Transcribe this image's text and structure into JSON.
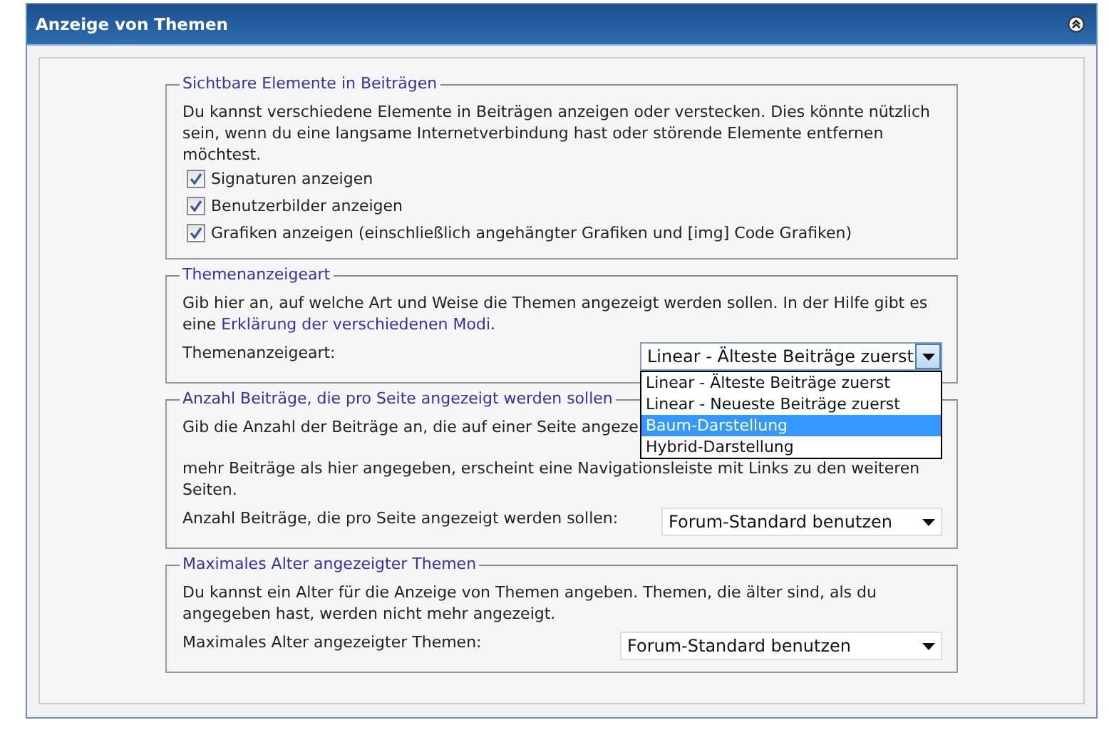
{
  "window": {
    "title": "Anzeige von Themen"
  },
  "sections": [
    {
      "legend": "Sichtbare Elemente in Beiträgen",
      "description": [
        "Du kannst verschiedene Elemente in Beiträgen anzeigen oder verstecken. Dies könnte nützlich sein, wenn du eine langsame Internetverbindung hast oder störende Elemente entfernen möchtest."
      ],
      "checkboxes": [
        {
          "label": "Signaturen anzeigen",
          "checked": true
        },
        {
          "label": "Benutzerbilder anzeigen",
          "checked": true
        },
        {
          "label": "Grafiken anzeigen (einschließlich angehängter Grafiken und [img] Code Grafiken)",
          "checked": true
        }
      ]
    },
    {
      "legend": "Themenanzeigeart",
      "description": [
        {
          "before": "Gib hier an, auf welche Art und Weise die Themen angezeigt werden sollen. In der Hilfe gibt es eine ",
          "link": "Erklärung der verschiedenen Modi",
          "after": "."
        }
      ],
      "select": {
        "label": "Themenanzeigeart:",
        "value": "Linear - Älteste Beiträge zuerst",
        "expanded": true,
        "options": [
          {
            "label": "Linear - Älteste Beiträge zuerst",
            "highlighted": false
          },
          {
            "label": "Linear - Neueste Beiträge zuerst",
            "highlighted": false
          },
          {
            "label": "Baum-Darstellung",
            "highlighted": true
          },
          {
            "label": "Hybrid-Darstellung",
            "highlighted": false
          }
        ]
      }
    },
    {
      "legend": "Anzahl Beiträge, die pro Seite angezeigt werden sollen",
      "description": [
        "Gib die Anzahl der Beiträge an, die auf einer Seite angeze",
        "mehr Beiträge als hier angegeben, erscheint eine Navigationsleiste mit Links zu den weiteren Seiten."
      ],
      "select": {
        "label": "Anzahl Beiträge, die pro Seite angezeigt werden sollen:",
        "value": "Forum-Standard benutzen",
        "expanded": false
      }
    },
    {
      "legend": "Maximales Alter angezeigter Themen",
      "description": [
        "Du kannst ein Alter für die Anzeige von Themen angeben. Themen, die älter sind, als du angegeben hast, werden nicht mehr angezeigt."
      ],
      "select": {
        "label": "Maximales Alter angezeigter Themen:",
        "value": "Forum-Standard benutzen",
        "expanded": false
      }
    }
  ]
}
